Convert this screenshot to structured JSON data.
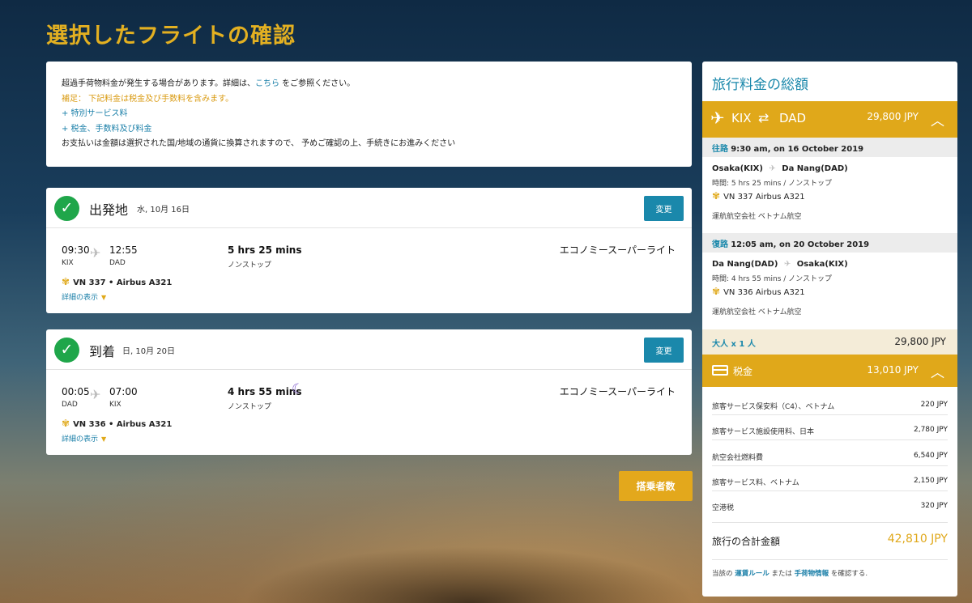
{
  "page_title": "選択したフライトの確認",
  "notice": {
    "line1_before": "超過手荷物料金が発生する場合があります。詳細は、",
    "line1_link": "こちら",
    "line1_after": " をご参照ください。",
    "line2": "補足： 下記料金は税金及び手数料を含みます。",
    "line3": "+ 特別サービス料",
    "line4": "+ 税金、手数料及び料金",
    "line5": "お支払いは金額は選択された国/地域の通貨に換算されますので、 予めご確認の上、手続きにお進みください"
  },
  "departure": {
    "label": "出発地",
    "date": "水, 10月 16日",
    "change_label": "変更",
    "dep_time": "09:30",
    "dep_code": "KIX",
    "arr_time": "12:55",
    "arr_code": "DAD",
    "duration": "5 hrs 25 mins",
    "stops": "ノンストップ",
    "fare": "エコノミースーパーライト",
    "flight_info": "VN 337 • Airbus A321",
    "details_label": "詳細の表示"
  },
  "arrival": {
    "label": "到着",
    "date": "日, 10月 20日",
    "change_label": "変更",
    "dep_time": "00:05",
    "dep_code": "DAD",
    "arr_time": "07:00",
    "arr_code": "KIX",
    "duration": "4 hrs 55 mins",
    "stops": "ノンストップ",
    "fare": "エコノミースーパーライト",
    "flight_info": "VN 336 • Airbus A321",
    "details_label": "詳細の表示"
  },
  "passenger_button": "搭乗者数",
  "summary": {
    "title": "旅行料金の総額",
    "route_from": "KIX",
    "route_to": "DAD",
    "route_price": "29,800 JPY",
    "outbound": {
      "direction": "往路",
      "when": "9:30 am, on 16 October 2019",
      "from": "Osaka(KIX)",
      "to": "Da Nang(DAD)",
      "duration": "時間: 5 hrs 25 mins / ノンストップ",
      "flight": "VN 337 Airbus A321",
      "operator": "運航航空会社 ベトナム航空"
    },
    "return": {
      "direction": "復路",
      "when": "12:05 am, on 20 October 2019",
      "from": "Da Nang(DAD)",
      "to": "Osaka(KIX)",
      "duration": "時間: 4 hrs 55 mins / ノンストップ",
      "flight": "VN 336 Airbus A321",
      "operator": "運航航空会社 ベトナム航空"
    },
    "adult_label": "大人 x 1 人",
    "adult_amount": "29,800 JPY",
    "tax_label": "税金",
    "tax_price": "13,010 JPY",
    "taxes": [
      {
        "name": "旅客サービス保安料（C4）、ベトナム",
        "value": "220 JPY"
      },
      {
        "name": "旅客サービス施設使用料、日本",
        "value": "2,780 JPY"
      },
      {
        "name": "航空会社燃料費",
        "value": "6,540 JPY"
      },
      {
        "name": "旅客サービス料、ベトナム",
        "value": "2,150 JPY"
      },
      {
        "name": "空港税",
        "value": "320 JPY"
      }
    ],
    "total_label": "旅行の合計金額",
    "total_amount": "42,810 JPY",
    "footer_before": "当該の ",
    "footer_link1": "運賃ルール",
    "footer_mid": " または ",
    "footer_link2": "手荷物情報",
    "footer_after": " を確認する."
  },
  "colors": {
    "gold": "#e0a81a",
    "blue": "#1a88ab",
    "green": "#1fa64a"
  }
}
